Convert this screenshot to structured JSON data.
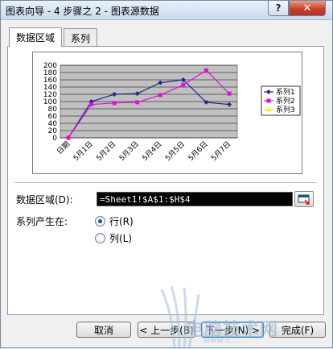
{
  "window": {
    "title": "图表向导 - 4 步骤之 2 - 图表源数据",
    "help_label": "?",
    "close_label": "✕"
  },
  "tabs": [
    {
      "label": "数据区域",
      "active": true
    },
    {
      "label": "系列",
      "active": false
    }
  ],
  "data_range": {
    "label": "数据区域(D):",
    "value": "=Sheet1!$A$1:$H$4"
  },
  "series_in": {
    "label": "系列产生在:",
    "options": [
      {
        "label": "行(R)",
        "checked": true
      },
      {
        "label": "列(L)",
        "checked": false
      }
    ]
  },
  "buttons": {
    "cancel": "取消",
    "back": "< 上一步(B)",
    "next": "下一步(N) >",
    "finish": "完成(F)"
  },
  "watermark": {
    "text": "电脑技术网",
    "sub": "www.it......"
  },
  "chart_data": {
    "type": "line",
    "categories": [
      "日期",
      "5月1日",
      "5月2日",
      "5月3日",
      "5月4日",
      "5月5日",
      "5月6日",
      "5月7日"
    ],
    "ylim": [
      0,
      200
    ],
    "yticks": [
      "0",
      "20",
      "40",
      "60",
      "80",
      "100",
      "120",
      "140",
      "160",
      "180",
      "200"
    ],
    "grid": true,
    "legend_position": "right",
    "series": [
      {
        "name": "系列1",
        "color": "#1f2a8a",
        "marker": "diamond",
        "values": [
          0,
          100,
          120,
          122,
          152,
          160,
          98,
          92
        ]
      },
      {
        "name": "系列2",
        "color": "#e010e0",
        "marker": "square",
        "values": [
          0,
          92,
          96,
          98,
          118,
          146,
          186,
          122
        ]
      },
      {
        "name": "系列3",
        "color": "#f0f000",
        "marker": "triangle",
        "values": [
          null,
          null,
          null,
          null,
          null,
          null,
          null,
          null
        ]
      }
    ]
  }
}
